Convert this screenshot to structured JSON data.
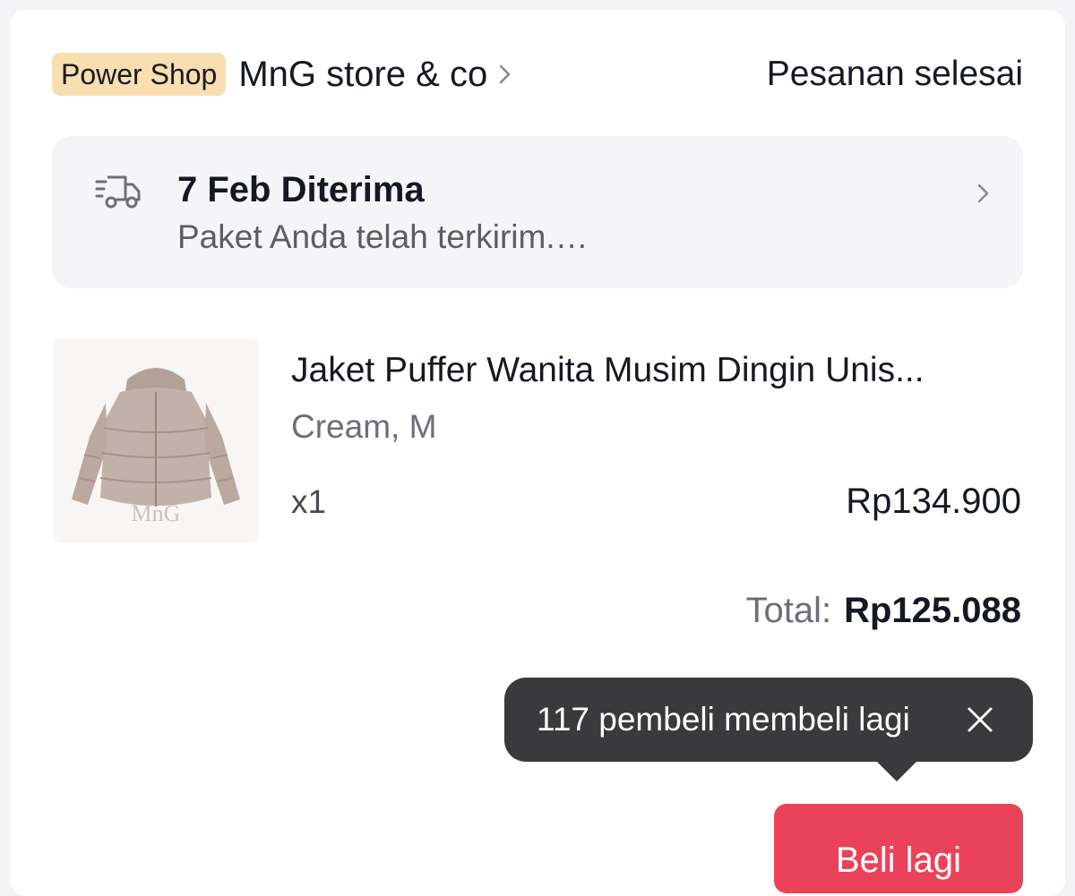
{
  "order": {
    "badge": "Power Shop",
    "shop_name": "MnG store & co",
    "status": "Pesanan selesai"
  },
  "delivery": {
    "title": "7 Feb Diterima",
    "subtitle": "Paket Anda telah terkirim.…",
    "icon": "delivery-truck-icon"
  },
  "product": {
    "title": "Jaket Puffer Wanita Musim Dingin Unis...",
    "variant": "Cream, M",
    "quantity": "x1",
    "price": "Rp134.900",
    "image_watermark": "MnG"
  },
  "total": {
    "label": "Total:",
    "value": "Rp125.088"
  },
  "tooltip": {
    "text": "117 pembeli membeli lagi"
  },
  "actions": {
    "buy_again": "Beli lagi"
  },
  "colors": {
    "badge_bg": "#f8deb0",
    "primary_button": "#ea4359",
    "tooltip_bg": "#3a3a3c"
  }
}
